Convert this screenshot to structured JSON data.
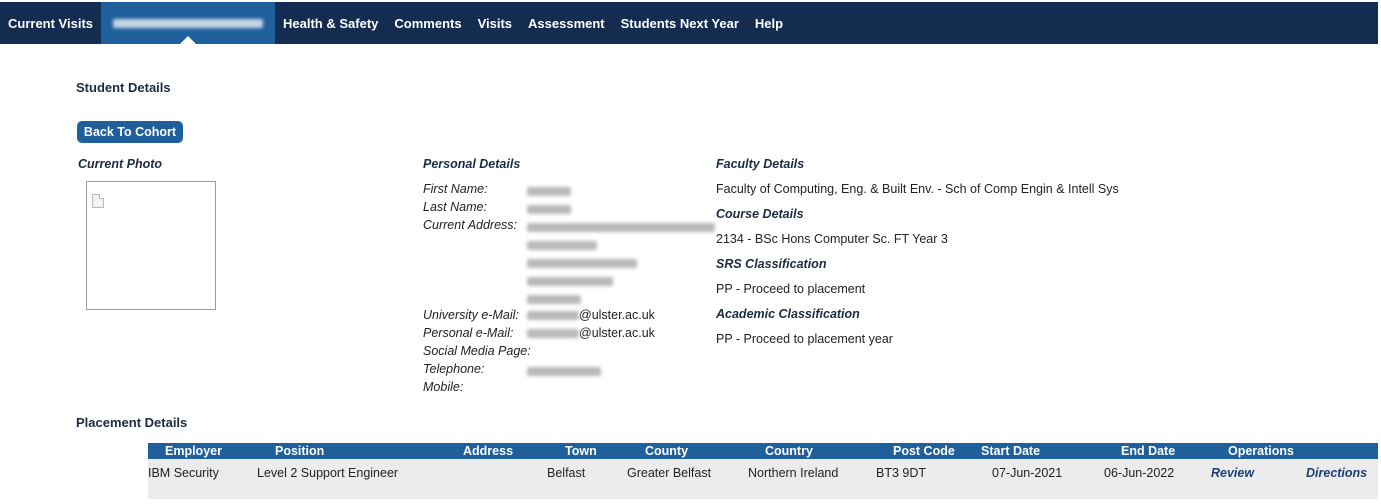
{
  "nav": {
    "tabs": [
      {
        "label": "Current Visits",
        "active": false
      },
      {
        "label": "[redacted]",
        "active": true
      },
      {
        "label": "Health & Safety",
        "active": false
      },
      {
        "label": "Comments",
        "active": false
      },
      {
        "label": "Visits",
        "active": false
      },
      {
        "label": "Assessment",
        "active": false
      },
      {
        "label": "Students Next Year",
        "active": false
      },
      {
        "label": "Help",
        "active": false
      }
    ]
  },
  "student_details": {
    "title": "Student Details",
    "back_button": "Back To Cohort",
    "current_photo_label": "Current Photo"
  },
  "personal": {
    "heading": "Personal Details",
    "first_name_label": "First Name:",
    "last_name_label": "Last Name:",
    "address_label": "Current Address:",
    "uni_email_label": "University e-Mail:",
    "uni_email_domain": "@ulster.ac.uk",
    "personal_email_label": "Personal e-Mail:",
    "personal_email_domain": "@ulster.ac.uk",
    "social_label": "Social Media Page:",
    "telephone_label": "Telephone:",
    "mobile_label": "Mobile:"
  },
  "faculty": {
    "faculty_heading": "Faculty Details",
    "faculty_value": "Faculty of Computing, Eng. & Built Env. - Sch of Comp Engin & Intell Sys",
    "course_heading": "Course Details",
    "course_value": "2134 - BSc Hons Computer Sc. FT Year 3",
    "srs_heading": "SRS Classification",
    "srs_value": "PP - Proceed to placement",
    "academic_heading": "Academic Classification",
    "academic_value": "PP - Proceed to placement year"
  },
  "placement": {
    "title": "Placement Details",
    "columns": [
      "Employer",
      "Position",
      "Address",
      "Town",
      "County",
      "Country",
      "Post Code",
      "Start Date",
      "End Date",
      "Operations"
    ],
    "row": {
      "employer": "IBM Security",
      "position": "Level 2 Support Engineer",
      "address": "",
      "town": "Belfast",
      "county": "Greater Belfast",
      "country": "Northern Ireland",
      "post_code": "BT3 9DT",
      "start_date": "07-Jun-2021",
      "end_date": "06-Jun-2022",
      "review": "Review",
      "directions": "Directions"
    }
  },
  "colors": {
    "nav_bg": "#132c4f",
    "accent": "#1f5f9c",
    "heading": "#1b2b44"
  }
}
